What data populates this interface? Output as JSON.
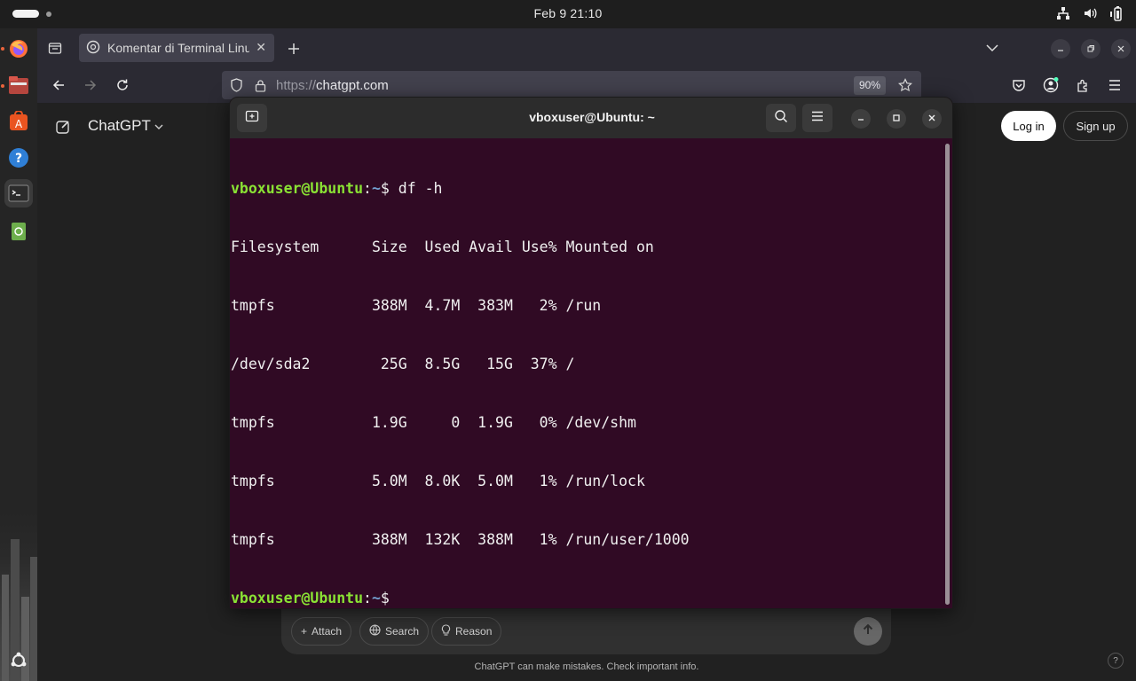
{
  "system": {
    "clock": "Feb 9  21:10"
  },
  "dock": {
    "items": [
      "firefox-icon",
      "files-icon",
      "app-center-icon",
      "help-icon",
      "terminal-icon",
      "trash-icon"
    ],
    "show_apps": "show-apps-icon"
  },
  "browser": {
    "tab_title": "Komentar di Terminal Linux",
    "url_scheme": "https://",
    "url_host": "chatgpt.com",
    "zoom": "90%"
  },
  "chatgpt": {
    "brand": "ChatGPT",
    "login": "Log in",
    "signup": "Sign up",
    "attach": "Attach",
    "search": "Search",
    "reason": "Reason",
    "disclaimer": "ChatGPT can make mistakes. Check important info.",
    "help": "?"
  },
  "terminal": {
    "title": "vboxuser@Ubuntu: ~",
    "prompt_user": "vboxuser@Ubuntu",
    "prompt_sep": ":",
    "prompt_path": "~",
    "prompt_end": "$ ",
    "command": "df -h",
    "output": [
      "Filesystem      Size  Used Avail Use% Mounted on",
      "tmpfs           388M  4.7M  383M   2% /run",
      "/dev/sda2        25G  8.5G   15G  37% /",
      "tmpfs           1.9G     0  1.9G   0% /dev/shm",
      "tmpfs           5.0M  8.0K  5.0M   1% /run/lock",
      "tmpfs           388M  132K  388M   1% /run/user/1000"
    ]
  },
  "colors": {
    "terminal_bg": "#300a24",
    "prompt_user": "#8ae234",
    "prompt_path": "#729fcf"
  }
}
